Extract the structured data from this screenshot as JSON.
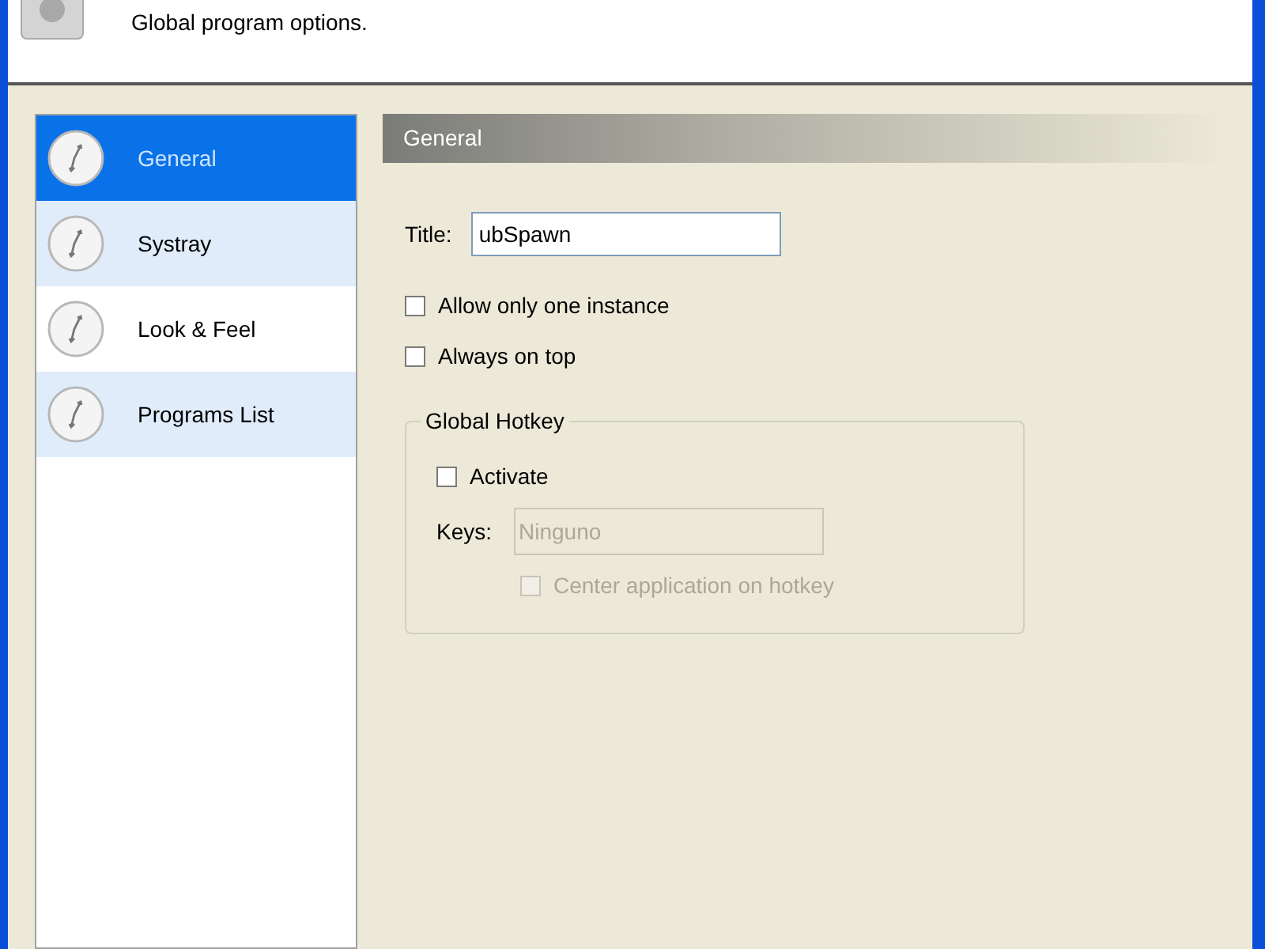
{
  "header": {
    "subtitle": "Global program options."
  },
  "sidebar": {
    "items": [
      {
        "label": "General",
        "selected": true
      },
      {
        "label": "Systray",
        "selected": false
      },
      {
        "label": "Look & Feel",
        "selected": false
      },
      {
        "label": "Programs List",
        "selected": false
      }
    ]
  },
  "panel": {
    "heading": "General",
    "title_label": "Title:",
    "title_value": "ubSpawn",
    "options": [
      {
        "label": "Allow only one instance",
        "checked": false
      },
      {
        "label": "Always on top",
        "checked": false
      }
    ],
    "hotkey": {
      "legend": "Global Hotkey",
      "activate": {
        "label": "Activate",
        "checked": false
      },
      "keys_label": "Keys:",
      "keys_placeholder": "Ninguno",
      "keys_disabled": true,
      "center": {
        "label": "Center application on hotkey",
        "checked": false,
        "disabled": true
      }
    }
  }
}
